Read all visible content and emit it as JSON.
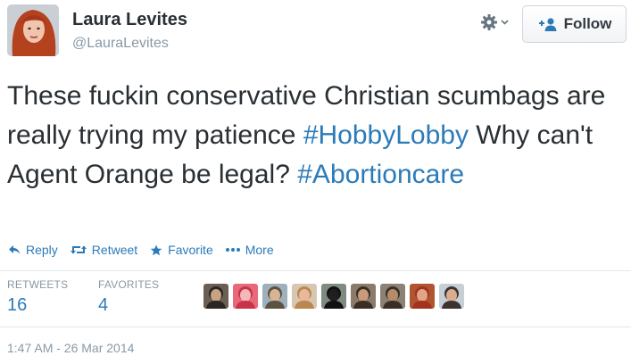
{
  "user": {
    "name": "Laura Levites",
    "handle": "@LauraLevites",
    "avatar_icon": "profile-photo"
  },
  "header": {
    "settings_icon": "gear-icon",
    "follow_label": "Follow",
    "follow_icon": "add-user-icon"
  },
  "tweet": {
    "segments": [
      {
        "text": "These fuckin conservative Christian scumbags are really trying my patience ",
        "hashtag": false
      },
      {
        "text": "#HobbyLobby",
        "hashtag": true
      },
      {
        "text": " Why can't Agent Orange be legal? ",
        "hashtag": false
      },
      {
        "text": "#Abortioncare",
        "hashtag": true
      }
    ]
  },
  "actions": {
    "reply": "Reply",
    "retweet": "Retweet",
    "favorite": "Favorite",
    "more": "More"
  },
  "stats": {
    "retweets_label": "RETWEETS",
    "retweets_value": "16",
    "favorites_label": "FAVORITES",
    "favorites_value": "4"
  },
  "favoriters": [
    {
      "icon": "avatar-man-dark-hair",
      "bg": "#6b5e52",
      "face": "#c9a184",
      "hair": "#2a2622"
    },
    {
      "icon": "avatar-pink",
      "bg": "#e86a7a",
      "face": "#f3b8b8",
      "hair": "#c9324a"
    },
    {
      "icon": "avatar-man-hat",
      "bg": "#9fb0bd",
      "face": "#d8b394",
      "hair": "#5d5142"
    },
    {
      "icon": "avatar-woman-blonde",
      "bg": "#d9c6b0",
      "face": "#e7b89a",
      "hair": "#b9874f"
    },
    {
      "icon": "avatar-black-cat",
      "bg": "#7f8a80",
      "face": "#1f1f1f",
      "hair": "#111111"
    },
    {
      "icon": "avatar-group",
      "bg": "#8b7b6a",
      "face": "#c79b7b",
      "hair": "#3a2e24"
    },
    {
      "icon": "avatar-man-beard",
      "bg": "#8c8175",
      "face": "#b58b6c",
      "hair": "#3b2f25"
    },
    {
      "icon": "avatar-redhead",
      "bg": "#b0552f",
      "face": "#e1a585",
      "hair": "#a3331e"
    },
    {
      "icon": "avatar-man-suit",
      "bg": "#c7cfd6",
      "face": "#d9ad8e",
      "hair": "#3a3330"
    }
  ],
  "timestamp": "1:47 AM - 26 Mar 2014",
  "colors": {
    "link": "#2b7bb9",
    "muted": "#8899a6",
    "text": "#292f33"
  }
}
